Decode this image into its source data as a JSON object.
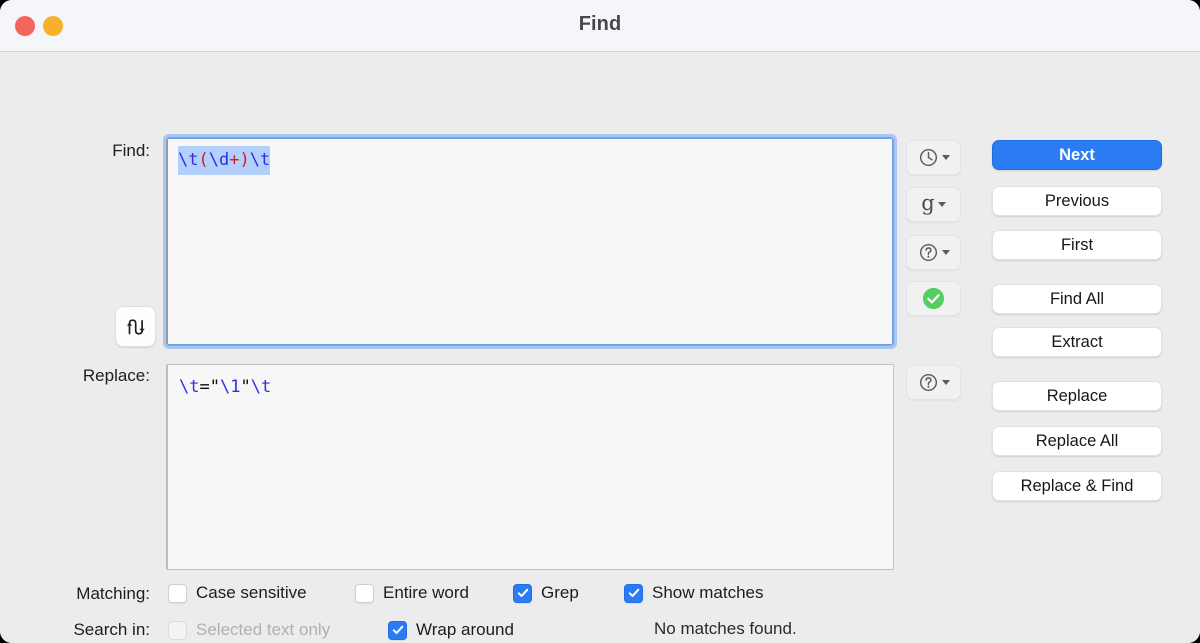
{
  "window": {
    "title": "Find",
    "traffic_lights": [
      {
        "name": "close",
        "color": "#f4645f"
      },
      {
        "name": "minimize",
        "color": "#f6b02c"
      }
    ],
    "accent_color": "#2b7cf3",
    "background_color": "#ececec",
    "titlebar_color": "#f4f6f9"
  },
  "labels": {
    "find": "Find:",
    "replace": "Replace:",
    "matching": "Matching:",
    "search_in": "Search in:"
  },
  "find_field": {
    "value": "\\t(\\d+)\\t",
    "selected": true,
    "focused": true,
    "tokens": [
      {
        "text": "\\t",
        "color": "#2a30e8",
        "kind": "blue"
      },
      {
        "text": "(",
        "color": "#cd1f23",
        "kind": "red"
      },
      {
        "text": "\\d",
        "color": "#2a30e8",
        "kind": "blue"
      },
      {
        "text": "+",
        "color": "#cd1f23",
        "kind": "red"
      },
      {
        "text": ")",
        "color": "#cd1f23",
        "kind": "red"
      },
      {
        "text": "\\t",
        "color": "#2a30e8",
        "kind": "blue"
      }
    ],
    "selection_color": "#b4cffb"
  },
  "replace_field": {
    "value": "\\t=\"\\1\"\\t",
    "selected": false,
    "focused": false,
    "tokens": [
      {
        "text": "\\t",
        "color": "#2a30e8",
        "kind": "blue"
      },
      {
        "text": "=\"",
        "color": "#0d0d0f",
        "kind": "dark"
      },
      {
        "text": "\\1",
        "color": "#2a30e8",
        "kind": "blue"
      },
      {
        "text": "\"",
        "color": "#0d0d0f",
        "kind": "dark"
      },
      {
        "text": "\\t",
        "color": "#2a30e8",
        "kind": "blue"
      }
    ]
  },
  "swap_button": {
    "icon": "swap-arrows-icon"
  },
  "icon_buttons": [
    {
      "id": "recents",
      "icon": "clock-icon",
      "glyph": "",
      "has_caret": true,
      "label": ""
    },
    {
      "id": "grep",
      "icon": "grep-letter-icon",
      "glyph": "g",
      "has_caret": true,
      "label": "g"
    },
    {
      "id": "findhelp",
      "icon": "question-mark-icon",
      "glyph": "",
      "has_caret": true,
      "label": ""
    },
    {
      "id": "valid",
      "icon": "green-check-icon",
      "glyph": "",
      "has_caret": false,
      "label": ""
    },
    {
      "id": "rephelp",
      "icon": "question-mark-icon",
      "glyph": "",
      "has_caret": true,
      "label": ""
    }
  ],
  "buttons": {
    "next": "Next",
    "previous": "Previous",
    "first": "First",
    "find_all": "Find All",
    "extract": "Extract",
    "replace": "Replace",
    "replace_all": "Replace All",
    "replace_and_find": "Replace & Find"
  },
  "checkboxes": {
    "case_sensitive": {
      "label": "Case sensitive",
      "checked": false,
      "disabled": false
    },
    "entire_word": {
      "label": "Entire word",
      "checked": false,
      "disabled": false
    },
    "grep": {
      "label": "Grep",
      "checked": true,
      "disabled": false
    },
    "show_matches": {
      "label": "Show matches",
      "checked": true,
      "disabled": false
    },
    "selected_text_only": {
      "label": "Selected text only",
      "checked": false,
      "disabled": true
    },
    "wrap_around": {
      "label": "Wrap around",
      "checked": true,
      "disabled": false
    }
  },
  "status": {
    "message": "No matches found."
  }
}
